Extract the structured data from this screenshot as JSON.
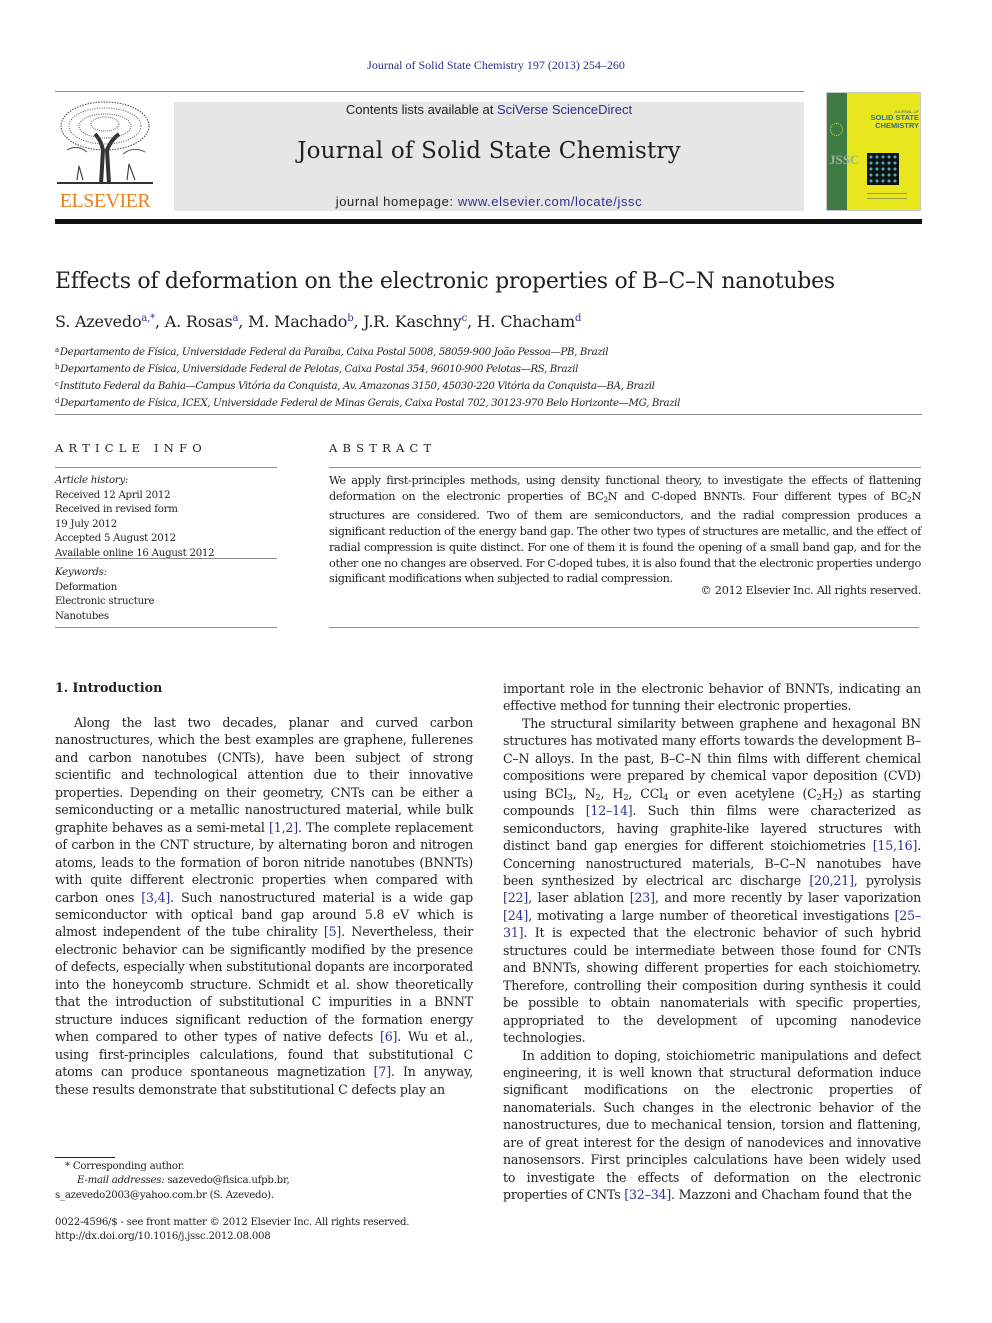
{
  "header": {
    "citation": "Journal of Solid State Chemistry 197 (2013) 254–260",
    "publisher_logo_text": "ELSEVIER",
    "contents_prefix": "Contents lists available at ",
    "contents_link": "SciVerse ScienceDirect",
    "journal_title": "Journal of Solid State Chemistry",
    "homepage_prefix": "journal homepage: ",
    "homepage_link": "www.elsevier.com/locate/jssc",
    "cover": {
      "title_small": "JOURNAL OF",
      "title_line1": "SOLID STATE",
      "title_line2": "CHEMISTRY",
      "spine_letters": "JSSC",
      "spine_color": "#3f7a45",
      "background_color": "#e8e61c"
    },
    "colors": {
      "link": "#2c3190",
      "elsevier_orange": "#f07f1a",
      "banner_grey": "#e6e6e6"
    }
  },
  "article": {
    "title": "Effects of deformation on the electronic properties of B–C–N nanotubes",
    "authors": [
      {
        "name": "S. Azevedo",
        "sup": "a,*"
      },
      {
        "name": "A. Rosas",
        "sup": "a"
      },
      {
        "name": "M. Machado",
        "sup": "b"
      },
      {
        "name": "J.R. Kaschny",
        "sup": "c"
      },
      {
        "name": "H. Chacham",
        "sup": "d"
      }
    ],
    "affiliations": [
      {
        "key": "a",
        "text": "Departamento de Física, Universidade Federal da Paraíba, Caixa Postal 5008, 58059-900 João Pessoa—PB, Brazil"
      },
      {
        "key": "b",
        "text": "Departamento de Física, Universidade Federal de Pelotas, Caixa Postal 354, 96010-900 Pelotas—RS, Brazil"
      },
      {
        "key": "c",
        "text": "Instituto Federal da Bahia—Campus Vitória da Conquista, Av. Amazonas 3150, 45030-220 Vitória da Conquista—BA, Brazil"
      },
      {
        "key": "d",
        "text": "Departamento de Física, ICEX, Universidade Federal de Minas Gerais, Caixa Postal 702, 30123-970 Belo Horizonte—MG, Brazil"
      }
    ]
  },
  "article_info": {
    "heading": "ARTICLE INFO",
    "history_label": "Article history:",
    "history": [
      "Received 12 April 2012",
      "Received in revised form",
      "19 July 2012",
      "Accepted 5 August 2012",
      "Available online 16 August 2012"
    ],
    "keywords_label": "Keywords:",
    "keywords": [
      "Deformation",
      "Electronic structure",
      "Nanotubes"
    ]
  },
  "abstract": {
    "heading": "ABSTRACT",
    "parts": {
      "p1": "We apply first-principles methods, using density functional theory, to investigate the effects of flattening deformation on the electronic properties of BC",
      "sub1": "2",
      "p2": "N and C-doped BNNTs. Four different types of BC",
      "sub2": "2",
      "p3": "N structures are considered. Two of them are semiconductors, and the radial compression produces a significant reduction of the energy band gap. The other two types of structures are metallic, and the effect of radial compression is quite distinct. For one of them it is found the opening of a small band gap, and for the other one no changes are observed. For C-doped tubes, it is also found that the electronic properties undergo significant modifications when subjected to radial compression."
    },
    "copyright": "© 2012 Elsevier Inc. All rights reserved."
  },
  "body": {
    "section_heading": "1.  Introduction",
    "left": {
      "p1_a": "Along the last two decades, planar and curved carbon nanostructures, which the best examples are graphene, fullerenes and carbon nanotubes (CNTs), have been subject of strong scientific and technological attention due to their innovative properties. Depending on their geometry, CNTs can be either a semiconducting or a metallic nanostructured material, while bulk graphite behaves as a semi-metal ",
      "ref_1": "[1,2]",
      "p1_b": ". The complete replacement of carbon in the CNT structure, by alternating boron and nitrogen atoms, leads to the formation of boron nitride nanotubes (BNNTs) with quite different electronic properties when compared with carbon ones ",
      "ref_2": "[3,4]",
      "p1_c": ". Such nanostructured material is a wide gap semiconductor with optical band gap around 5.8 eV which is almost independent of the tube chirality ",
      "ref_3": "[5]",
      "p1_d": ". Nevertheless, their electronic behavior can be significantly modified by the presence of defects, especially when substitutional dopants are incorporated into the honeycomb structure. Schmidt et al. show theoretically that the introduction of substitutional C impurities in a BNNT structure induces significant reduction of the formation energy when compared to other types of native defects ",
      "ref_4": "[6]",
      "p1_e": ". Wu et al., using first-principles calculations, found that substitutional C atoms can produce spontaneous magnetization ",
      "ref_5": "[7]",
      "p1_f": ". In anyway, these results demonstrate that substitutional C defects play an"
    },
    "right": {
      "p1_cont": "important role in the electronic behavior of BNNTs, indicating an effective method for tunning their electronic properties.",
      "p2_a": "The structural similarity between graphene and hexagonal BN structures has motivated many efforts towards the development B–C–N alloys. In the past, B–C–N thin films with different chemical compositions were prepared by chemical vapor deposition (CVD) using BCl",
      "sub_bcl": "3",
      "p2_b": ", N",
      "sub_n": "2",
      "p2_c": ", H",
      "sub_h": "2",
      "p2_d": ", CCl",
      "sub_ccl": "4",
      "p2_e": " or even acetylene (C",
      "sub_c": "2",
      "p2_f": "H",
      "sub_h2": "2",
      "p2_g": ") as starting compounds ",
      "ref_a": "[12–14]",
      "p2_h": ". Such thin films were characterized as semiconductors, having graphite-like layered structures with distinct band gap energies for different stoichiometries ",
      "ref_b": "[15,16]",
      "p2_i": ". Concerning nanostructured materials, B–C–N nanotubes have been synthesized by electrical arc discharge ",
      "ref_c": "[20,21]",
      "p2_j": ", pyrolysis ",
      "ref_d": "[22]",
      "p2_k": ", laser ablation ",
      "ref_e": "[23]",
      "p2_l": ", and more recently by laser vaporization ",
      "ref_f": "[24]",
      "p2_m": ", motivating a large number of theoretical investigations ",
      "ref_g": "[25–31]",
      "p2_n": ". It is expected that the electronic behavior of such hybrid structures could be intermediate between those found for CNTs and BNNTs, showing different properties for each stoichiometry. Therefore, controlling their composition during synthesis it could be possible to obtain nanomaterials with specific properties, appropriated to the development of upcoming nanodevice technologies.",
      "p3_a": "In addition to doping, stoichiometric manipulations and defect engineering, it is well known that structural deformation induce significant modifications on the electronic properties of nanomaterials. Such changes in the electronic behavior of the nanostructures, due to mechanical tension, torsion and flattening, are of great interest for the design of nanodevices and innovative nanosensors. First principles calculations have been widely used to investigate the effects of deformation on the electronic properties of CNTs ",
      "ref_h": "[32–34]",
      "p3_b": ". Mazzoni and Chacham found that the"
    }
  },
  "footnotes": {
    "corresponding": "* Corresponding author.",
    "email_label": "E-mail addresses:",
    "email_1": " sazevedo@fisica.ufpb.br,",
    "email_2": "s_azevedo2003@yahoo.com.br (S. Azevedo).",
    "issn_line": "0022-4596/$ - see front matter © 2012 Elsevier Inc. All rights reserved.",
    "doi": "http://dx.doi.org/10.1016/j.jssc.2012.08.008"
  }
}
